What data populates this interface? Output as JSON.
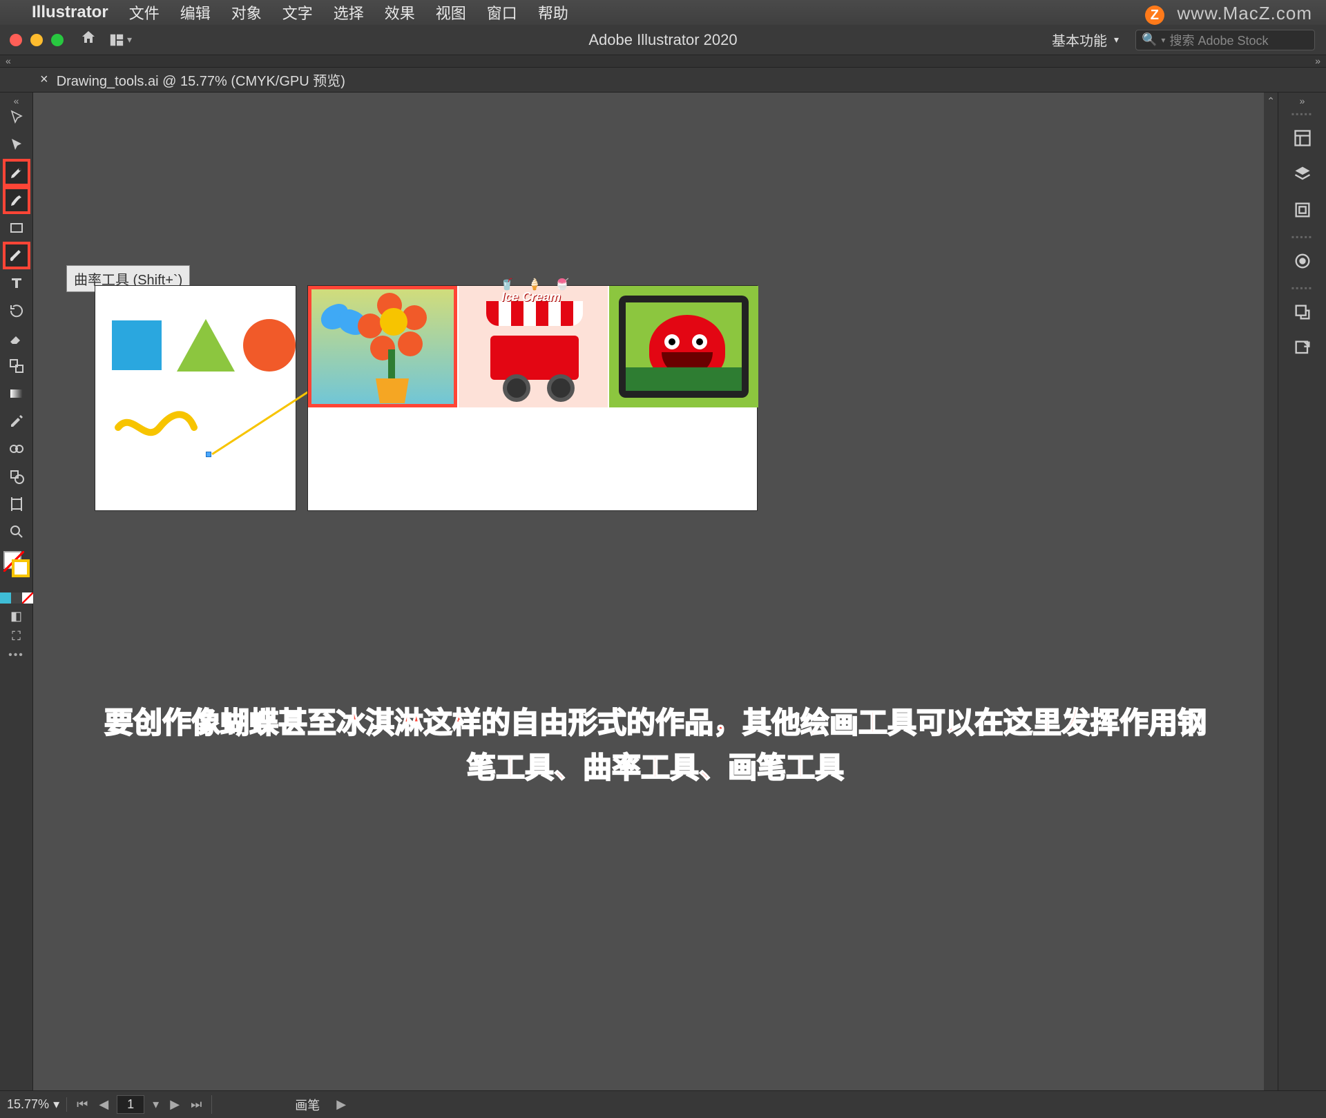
{
  "mac_menu": {
    "app_name": "Illustrator",
    "items": [
      "文件",
      "编辑",
      "对象",
      "文字",
      "选择",
      "效果",
      "视图",
      "窗口",
      "帮助"
    ]
  },
  "watermark": {
    "badge": "Z",
    "text": "www.MacZ.com"
  },
  "titlebar": {
    "app_title": "Adobe Illustrator 2020",
    "workspace_label": "基本功能",
    "search_placeholder": "搜索 Adobe Stock"
  },
  "document_tab": "Drawing_tools.ai @ 15.77% (CMYK/GPU 预览)",
  "tooltip": "曲率工具 (Shift+`)",
  "tools": [
    {
      "name": "selection-tool",
      "hl": false
    },
    {
      "name": "direct-selection-tool",
      "hl": false
    },
    {
      "name": "pen-tool",
      "hl": true
    },
    {
      "name": "curvature-tool",
      "hl": true
    },
    {
      "name": "rectangle-tool",
      "hl": false
    },
    {
      "name": "paintbrush-tool",
      "hl": true
    },
    {
      "name": "type-tool",
      "hl": false
    },
    {
      "name": "rotate-tool",
      "hl": false
    },
    {
      "name": "eraser-tool",
      "hl": false
    },
    {
      "name": "scale-tool",
      "hl": false
    },
    {
      "name": "gradient-tool",
      "hl": false
    },
    {
      "name": "eyedropper-tool",
      "hl": false
    },
    {
      "name": "blend-tool",
      "hl": false
    },
    {
      "name": "shape-builder-tool",
      "hl": false
    },
    {
      "name": "artboard-tool",
      "hl": false
    },
    {
      "name": "zoom-tool",
      "hl": false
    }
  ],
  "color_row": [
    "#3fbdd6",
    "#444444",
    "#ff4536"
  ],
  "right_panels": [
    "properties",
    "layers",
    "libraries",
    "appearance",
    "graphic-styles",
    "export"
  ],
  "artboards": {
    "ab2_thumbs": {
      "icecream_sign": "Ice Cream"
    }
  },
  "caption_line1": "要创作像蝴蝶甚至冰淇淋这样的自由形式的作品，其他绘画工具可以在这里发挥作用钢",
  "caption_line2": "笔工具、曲率工具、画笔工具",
  "statusbar": {
    "zoom": "15.77%",
    "artboard_index": "1",
    "artboard_name": "画笔"
  }
}
